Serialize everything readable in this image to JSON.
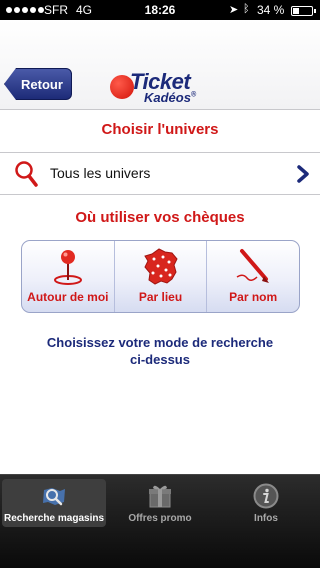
{
  "status_bar": {
    "carrier": "SFR",
    "network": "4G",
    "time": "18:26",
    "battery_text": "34 %",
    "battery_level": 0.34
  },
  "header": {
    "back_label": "Retour",
    "logo_line1": "Ticket",
    "logo_line2": "Kadéos",
    "logo_mark": "®",
    "brand_blue": "#1c2a7a",
    "brand_red": "#d2140a"
  },
  "univers": {
    "title": "Choisir l'univers",
    "selected": "Tous les univers",
    "icon": "search-icon"
  },
  "cheques": {
    "title": "Où utiliser vos chèques",
    "options": [
      {
        "label": "Autour de moi",
        "icon": "map-pin-icon"
      },
      {
        "label": "Par lieu",
        "icon": "france-map-icon"
      },
      {
        "label": "Par nom",
        "icon": "pencil-icon"
      }
    ]
  },
  "instruction": {
    "line1": "Choisissez votre mode de recherche",
    "line2": "ci-dessus"
  },
  "tabs": [
    {
      "label": "Recherche magasins",
      "icon": "store-search-icon",
      "active": true
    },
    {
      "label": "Offres promo",
      "icon": "gift-icon",
      "active": false
    },
    {
      "label": "Infos",
      "icon": "info-icon",
      "active": false
    }
  ],
  "colors": {
    "accent_red": "#d01818",
    "tab_bar_bg": "#0a0a0a"
  }
}
